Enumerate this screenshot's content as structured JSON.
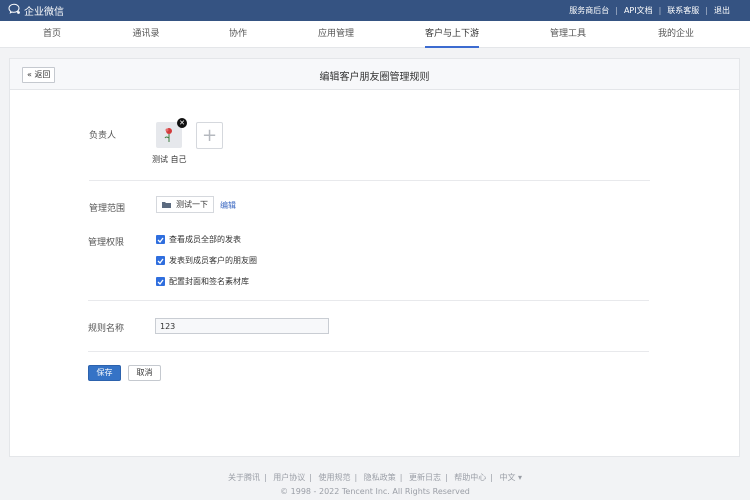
{
  "app": {
    "name": "企业微信"
  },
  "topbar": {
    "links": [
      "服务商后台",
      "API文档",
      "联系客服",
      "退出"
    ]
  },
  "nav": {
    "tabs": [
      {
        "label": "首页",
        "active": false
      },
      {
        "label": "通讯录",
        "active": false
      },
      {
        "label": "协作",
        "active": false
      },
      {
        "label": "应用管理",
        "active": false
      },
      {
        "label": "客户与上下游",
        "active": true
      },
      {
        "label": "管理工具",
        "active": false
      },
      {
        "label": "我的企业",
        "active": false
      }
    ]
  },
  "page": {
    "back_label": "« 返回",
    "title": "编辑客户朋友圈管理规则"
  },
  "owner": {
    "label": "负责人",
    "member_name": "测试 自己",
    "add_icon": "+"
  },
  "scope": {
    "label": "管理范围",
    "department": "测试一下",
    "edit_link": "编辑"
  },
  "permissions": {
    "label": "管理权限",
    "items": [
      {
        "label": "查看成员全部的发表",
        "checked": true
      },
      {
        "label": "发表到成员客户的朋友圈",
        "checked": true
      },
      {
        "label": "配置封面和签名素材库",
        "checked": true
      }
    ]
  },
  "rule": {
    "label": "规则名称",
    "value": "123"
  },
  "actions": {
    "save_label": "保存",
    "cancel_label": "取消"
  },
  "footer": {
    "links": [
      "关于腾讯",
      "用户协议",
      "使用规范",
      "隐私政策",
      "更新日志",
      "帮助中心",
      "中文 ▾"
    ],
    "copyright": "© 1998 - 2022 Tencent Inc. All Rights Reserved"
  },
  "colors": {
    "topbar": "#355382",
    "accent": "#3573c6",
    "checkbox": "#2f6ede"
  }
}
